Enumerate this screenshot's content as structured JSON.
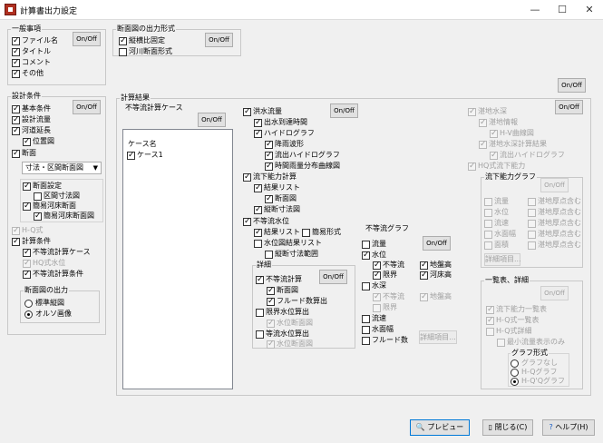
{
  "window": {
    "title": "計算書出力設定",
    "minimize": "—",
    "maximize": "☐",
    "close": "✕"
  },
  "general": {
    "title": "一般事項",
    "onoff": "On/Off",
    "items": [
      {
        "label": "ファイル名",
        "checked": true
      },
      {
        "label": "タイトル",
        "checked": true
      },
      {
        "label": "コメント",
        "checked": true
      },
      {
        "label": "その他",
        "checked": true
      }
    ]
  },
  "section_format": {
    "title": "断面図の出力形式",
    "onoff": "On/Off",
    "items": [
      {
        "label": "縦横比固定",
        "checked": true
      },
      {
        "label": "河川断面形式",
        "checked": false
      }
    ]
  },
  "design_conditions": {
    "title": "設計条件",
    "onoff": "On/Off",
    "basic": "基本条件",
    "design_flow": "設計流量",
    "river_extension": "河道延長",
    "location_map": "位置図",
    "section": "断面",
    "section_select": "寸法・区間断面図",
    "section_settings": "断面設定",
    "interval_dimension": "区間寸法図",
    "simple_section": "簡易河床断面",
    "simple_section_fig": "簡易河床断面図",
    "hq": "H-Q式",
    "calc_conditions": "計算条件",
    "nonuniform_case": "不等流計算ケース",
    "hq_water": "HQ式水位",
    "nonuniform_conditions": "不等流計算条件",
    "output_title": "断面図の出力",
    "radio_standard": "標準縦図",
    "radio_online": "オルソ画像"
  },
  "results": {
    "title": "計算結果",
    "global_onoff": "On/Off",
    "nonuniform_case": {
      "title": "不等流計算ケース",
      "onoff": "On/Off",
      "header": "ケース名",
      "cases": [
        {
          "label": "ケース1",
          "checked": true
        }
      ]
    },
    "col2": {
      "onoff": "On/Off",
      "flood_flow": "洪水流量",
      "outflow_calc": "出水到達時間",
      "hydrograph": "ハイドログラフ",
      "rain_wave": "降雨波形",
      "outflow_hydro": "流出ハイドログラフ",
      "time_dist": "時間雨量分布曲線図",
      "flow_capacity": "流下能力計算",
      "result_list": "結果リスト",
      "section_fig": "断面図",
      "longitudinal": "縦断寸法図",
      "nonuniform_wl": "不等流水位",
      "result_list2": "結果リスト",
      "simple_form": "簡易形式",
      "water_level_result": "水位図結果リスト",
      "longitudinal_range": "縦断寸法範囲",
      "detail_title": "詳細",
      "detail_onoff": "On/Off",
      "nonuniform_calc": "不等流計算",
      "section_fig2": "断面図",
      "froude": "フルード数算出",
      "critical_depth": "限界水位算出",
      "water_cross": "水位断面図",
      "uniform_depth": "等流水位算出",
      "water_cross2": "水位断面図"
    },
    "graph": {
      "title": "不等流グラフ",
      "onoff": "On/Off",
      "flow": "流量",
      "water_level": "水位",
      "ground_height": "地盤高",
      "uniform": "不等流",
      "river_height": "河床高",
      "limit": "限界",
      "depth": "水深",
      "uniform2": "不等流",
      "limit2": "限界",
      "ground2": "地盤高",
      "velocity": "流速",
      "water_width": "水面幅",
      "froude": "フルード数",
      "detail_btn": "詳細項目..."
    },
    "col4": {
      "onoff": "On/Off",
      "pond": "湛地水深",
      "pond_info": "湛地情報",
      "hv_table": "H-V曲線図",
      "pond_calc": "湛地水深計算結果",
      "outflow_hydro": "流出ハイドログラフ",
      "hq_capacity": "HQ式流下能力",
      "capacity_graph": {
        "title": "流下能力グラフ",
        "onoff": "On/Off",
        "detail_btn": "詳細項目..."
      },
      "rows": [
        {
          "left": "流量",
          "right": "湛地厚点含む"
        },
        {
          "left": "水位",
          "right": "湛地厚点含む"
        },
        {
          "left": "流速",
          "right": "湛地厚点含む"
        },
        {
          "left": "水面幅",
          "right": "湛地厚点含む"
        },
        {
          "left": "面積",
          "right": "湛地厚点含む"
        }
      ],
      "list_title": "一覧表、詳細",
      "list_onoff": "On/Off",
      "capacity_list": "流下能力一覧表",
      "hq_list": "H-Q式一覧表",
      "hq_detail": "H-Q式詳細",
      "min_water": "最小流量表示のみ",
      "graph_form": "グラフ形式",
      "graph_none": "グラフなし",
      "graph_hq": "H-Qグラフ",
      "graph_hqq": "H-Q'Qグラフ"
    }
  },
  "footer": {
    "preview": "プレビュー",
    "close": "閉じる(C)",
    "help": "ヘルプ(H)"
  }
}
